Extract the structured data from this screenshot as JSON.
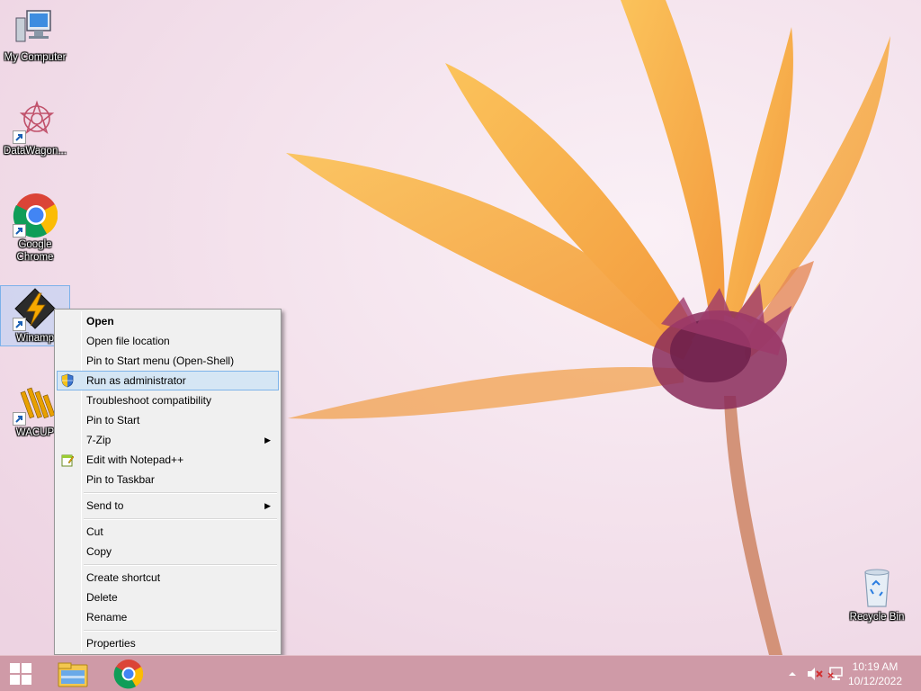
{
  "desktop": {
    "icons": [
      {
        "label": "My Computer"
      },
      {
        "label": "DataWagon..."
      },
      {
        "label": "Google Chrome"
      },
      {
        "label": "Winamp"
      },
      {
        "label": "WACUP"
      },
      {
        "label": "Recycle Bin"
      }
    ]
  },
  "context_menu": {
    "items": [
      {
        "label": "Open"
      },
      {
        "label": "Open file location"
      },
      {
        "label": "Pin to Start menu (Open-Shell)"
      },
      {
        "label": "Run as administrator",
        "icon": "uac-shield-icon"
      },
      {
        "label": "Troubleshoot compatibility"
      },
      {
        "label": "Pin to Start"
      },
      {
        "label": "7-Zip",
        "submenu": true
      },
      {
        "label": "Edit with Notepad++",
        "icon": "notepad-plus-plus-icon"
      },
      {
        "label": "Pin to Taskbar"
      },
      {
        "label": "Send to",
        "submenu": true
      },
      {
        "label": "Cut"
      },
      {
        "label": "Copy"
      },
      {
        "label": "Create shortcut"
      },
      {
        "label": "Delete"
      },
      {
        "label": "Rename"
      },
      {
        "label": "Properties"
      }
    ],
    "highlight_color": "#d5e6f4",
    "highlight_border": "#7eb4ea"
  },
  "taskbar": {
    "color": "#cf9aa7",
    "clock": {
      "time": "10:19 AM",
      "date": "10/12/2022"
    },
    "pinned": [
      "windows-start-icon",
      "file-explorer-icon",
      "chrome-icon"
    ],
    "tray": [
      "show-hidden-icons-chevron",
      "speaker-muted-icon",
      "network-icon"
    ]
  }
}
